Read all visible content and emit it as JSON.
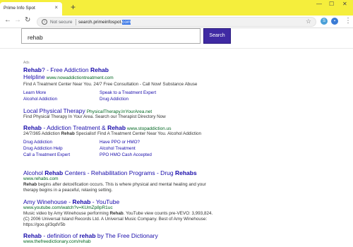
{
  "tab": {
    "title": "Prime Info Spot",
    "close": "×",
    "new_tab": "+"
  },
  "window": {
    "minimize": "—",
    "maximize": "☐",
    "close": "✕"
  },
  "address_bar": {
    "security": "Not secure",
    "url_prefix": "search.primeinfospot.",
    "url_selected": "com"
  },
  "search": {
    "query": "rehab",
    "button_label": "Search"
  },
  "ads_label": "Ads",
  "results": [
    {
      "title_pre": "",
      "title_b1": "Rehab",
      "title_mid": "? - Free Addiction ",
      "title_b2": "Rehab",
      "title_line2": "Helpline",
      "url": "www.nowaddictiontreatment.com",
      "desc": "Find A Treatment Center Near You. 24/7 Free Consultation - Call Now! Substance Abuse",
      "sitelinks": [
        "Learn More",
        "Speak to a Treatment Expert",
        "Alcohol Addiction",
        "Drug Addiction"
      ]
    },
    {
      "title": "Local Physical Therapy",
      "url": "PhysicalTherapy.InYourArea.net",
      "desc": "Find Physical Therapy In Your Area. Search our Therapist Directory Now"
    },
    {
      "title_b1": "Rehab",
      "title_mid": " - Addiction Treatment & ",
      "title_b2": "Rehab",
      "url": "www.stopaddiction.us",
      "desc_pre": "24/7/365 Addiction ",
      "desc_b": "Rehab",
      "desc_post": " Specialist! Find A Treatment Center Near You. Alcohol Addiction",
      "sitelinks": [
        "Drug Addiction",
        "Have PPO or HMO?",
        "Drug Addiction Help",
        "Alcohol Treatment",
        "Call a Treatment Expert",
        "PPO HMO Cash Accepted"
      ]
    },
    {
      "title_pre": "Alcohol ",
      "title_b1": "Rehab",
      "title_mid": " Centers - Rehabilitation Programs - Drug ",
      "title_b2": "Rehabs",
      "url": "www.rehabs.com",
      "desc_b": "Rehab",
      "desc_post": " begins after detoxification occurs. This is where physical and mental healing and your therapy begins in a peaceful, relaxing setting."
    },
    {
      "title_pre": "Amy Winehouse - ",
      "title_b1": "Rehab",
      "title_mid": " - YouTube",
      "url": "www.youtube.com/watch?v=KUmZp8pR1uc",
      "desc_pre": "Music video by Amy Winehouse performing ",
      "desc_b": "Rehab",
      "desc_post": ". YouTube view counts pre-VEVO: 3,993,824. (C) 2006 Universal Island Records Ltd. A Universal Music Company. Best of Amy Winehouse: https://goo.gl/3qdV5b"
    },
    {
      "title_b1": "Rehab",
      "title_mid": " - definition of ",
      "title_b2": "rehab",
      "title_post": " by The Free Dictionary",
      "url": "www.thefreedictionary.com/rehab"
    }
  ],
  "colors": {
    "tab_strip": "#f5ee3c",
    "link": "#1a0dab",
    "url_green": "#006621",
    "search_button": "#3f2aa3"
  }
}
